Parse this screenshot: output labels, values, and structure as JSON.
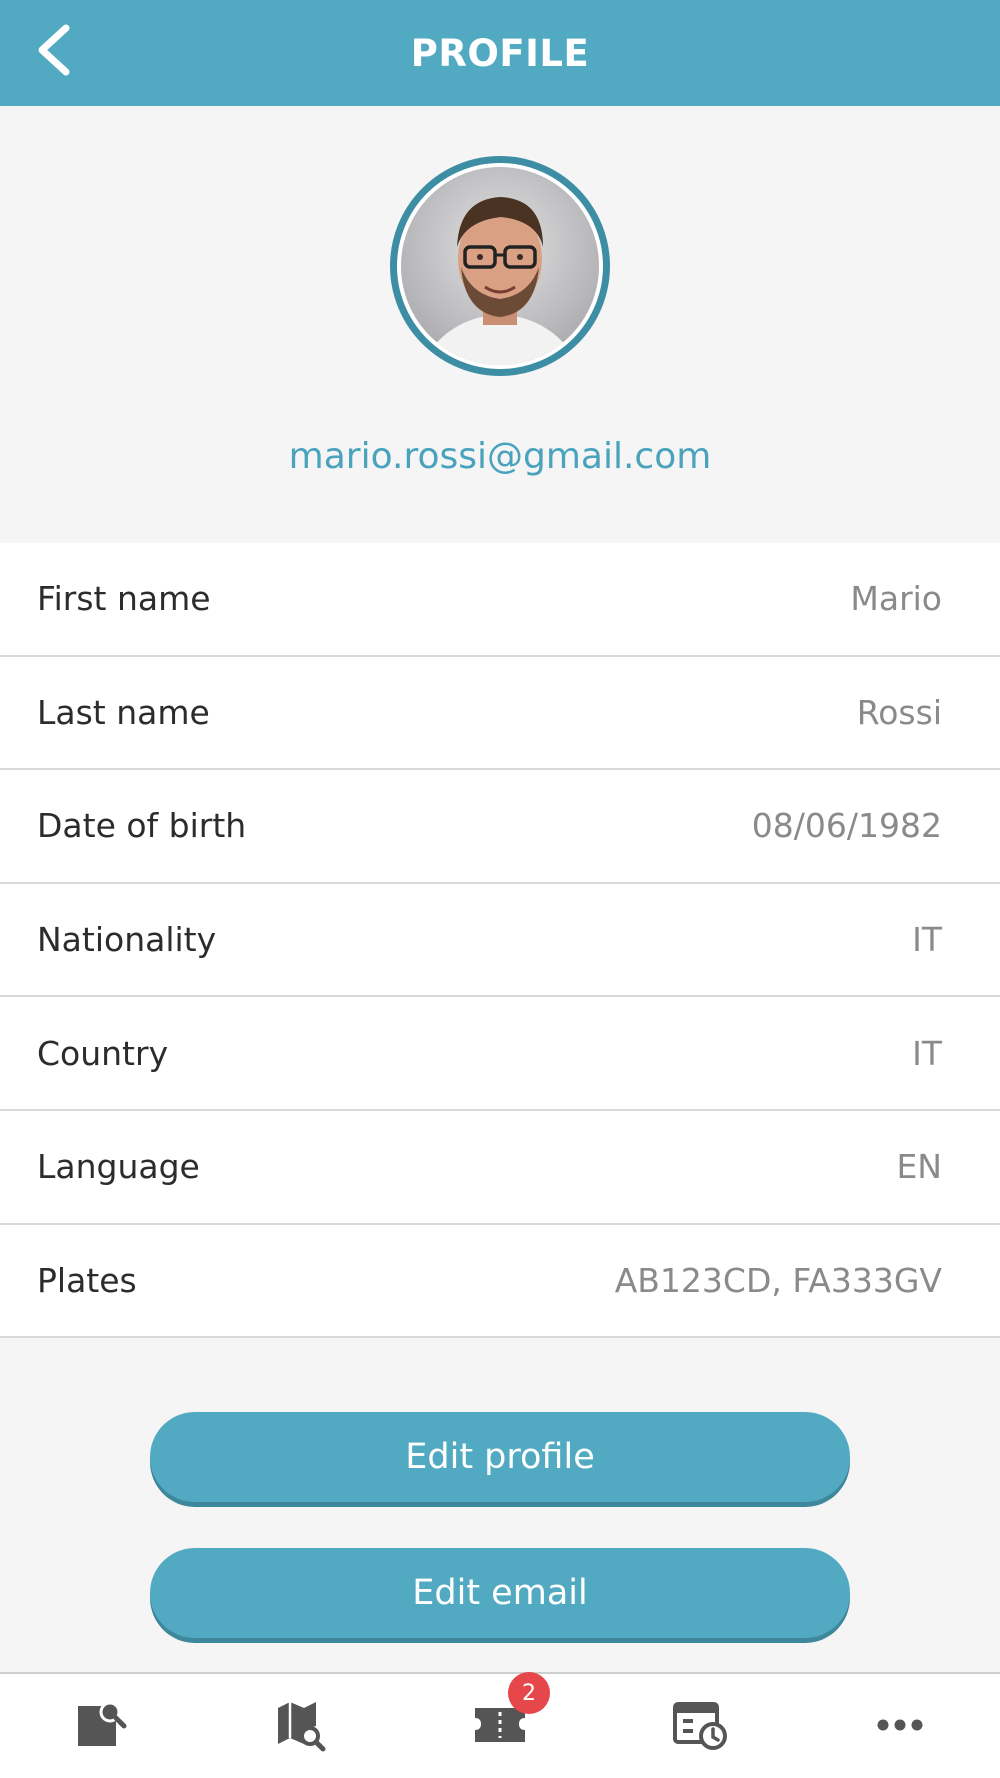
{
  "header": {
    "title": "PROFILE",
    "back_icon": "chevron-left-icon"
  },
  "profile": {
    "email": "mario.rossi@gmail.com"
  },
  "fields": [
    {
      "label": "First name",
      "value": "Mario"
    },
    {
      "label": "Last name",
      "value": "Rossi"
    },
    {
      "label": "Date of birth",
      "value": "08/06/1982"
    },
    {
      "label": "Nationality",
      "value": "IT"
    },
    {
      "label": "Country",
      "value": "IT"
    },
    {
      "label": "Language",
      "value": "EN"
    },
    {
      "label": "Plates",
      "value": "AB123CD, FA333GV"
    }
  ],
  "actions": {
    "edit_profile": "Edit profile",
    "edit_email": "Edit email"
  },
  "bottom_nav": {
    "items": [
      {
        "icon": "document-search-icon"
      },
      {
        "icon": "map-search-icon"
      },
      {
        "icon": "ticket-icon",
        "badge": "2"
      },
      {
        "icon": "calendar-clock-icon"
      },
      {
        "icon": "more-icon"
      }
    ]
  },
  "colors": {
    "accent": "#51aac2",
    "avatar_ring": "#3d8ea4",
    "badge": "#e6474a",
    "nav_icon": "#555555"
  }
}
